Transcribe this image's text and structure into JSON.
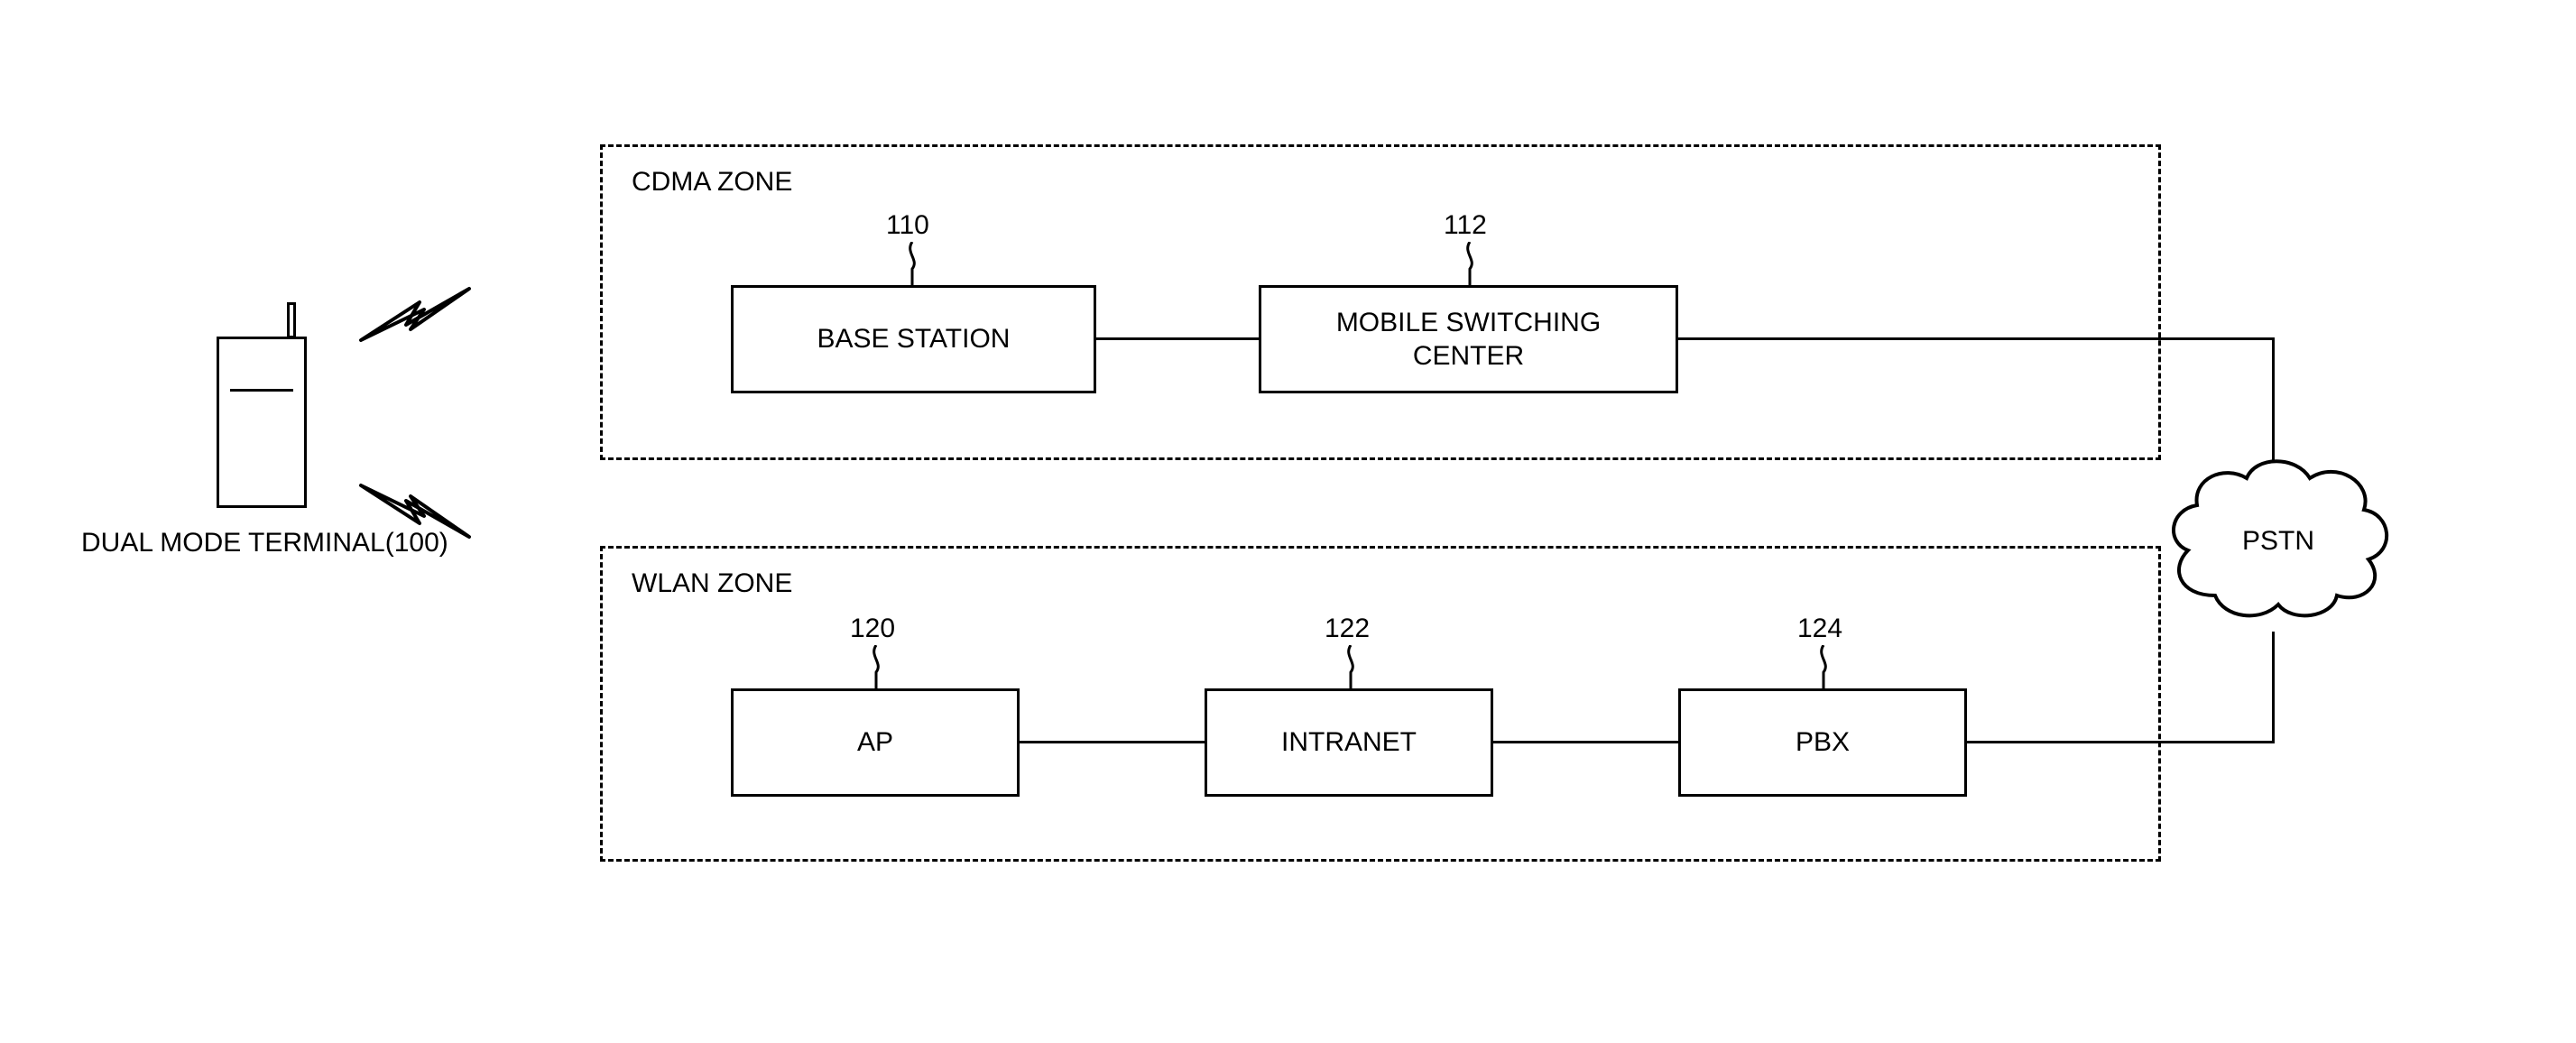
{
  "terminal": {
    "label": "DUAL MODE TERMINAL(100)"
  },
  "cdma_zone": {
    "title": "CDMA ZONE",
    "base_station": {
      "label": "BASE STATION",
      "ref": "110"
    },
    "msc": {
      "label": "MOBILE SWITCHING\nCENTER",
      "ref": "112"
    }
  },
  "wlan_zone": {
    "title": "WLAN ZONE",
    "ap": {
      "label": "AP",
      "ref": "120"
    },
    "intranet": {
      "label": "INTRANET",
      "ref": "122"
    },
    "pbx": {
      "label": "PBX",
      "ref": "124"
    }
  },
  "pstn": {
    "label": "PSTN"
  }
}
